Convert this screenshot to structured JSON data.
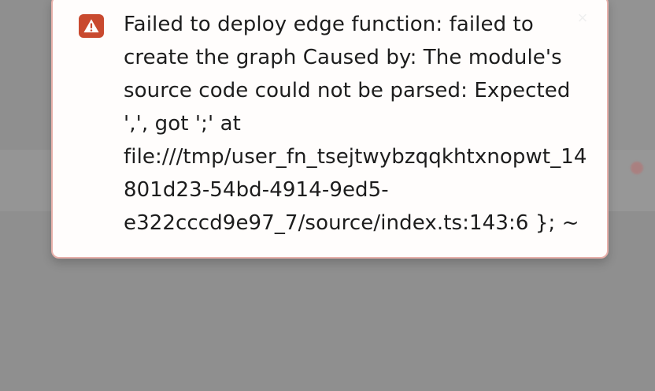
{
  "toast": {
    "type": "error",
    "message": "Failed to deploy edge function: failed to create the graph Caused by: The module's source code could not be parsed: Expected ',', got ';' at file:///tmp/user_fn_tsejtwybzqqkhtxnopwt_14801d23-54bd-4914-9ed5-e322cccd9e97_7/source/index.ts:143:6 }; ~",
    "icon": "warning-icon",
    "close_icon": "close-icon",
    "close_label": "×"
  },
  "colors": {
    "overlay": "#8f8f8f",
    "toast_background": "#fffdfc",
    "toast_border": "#e7b0aa",
    "error_accent": "#c94a2f",
    "text": "#1d1d1d"
  }
}
